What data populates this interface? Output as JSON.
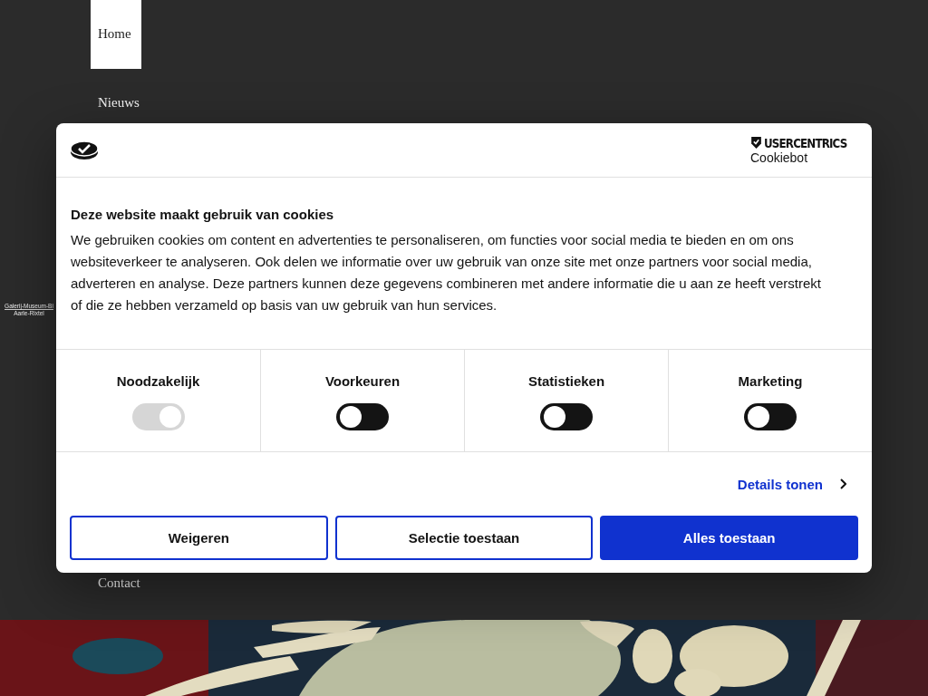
{
  "nav": [
    {
      "label": "Home",
      "selected": true
    },
    {
      "label": "Nieuws",
      "selected": false
    }
  ],
  "logo": {
    "line_1": "Galerij-Museum-Bi",
    "line_2": "Aarle-Rixtel"
  },
  "nav_bottom": {
    "label": "Contact"
  },
  "cookie_dialog": {
    "brand": "USERCENTRICS",
    "product": "Cookiebot",
    "title": "Deze website maakt gebruik van cookies",
    "text": "We gebruiken cookies om content en advertenties te personaliseren, om functies voor social media te bieden en om ons websiteverkeer te analyseren. Ook delen we informatie over uw gebruik van onze site met onze partners voor social media, adverteren en analyse. Deze partners kunnen deze gegevens combineren met andere informatie die u aan ze heeft verstrekt of die ze hebben verzameld op basis van uw gebruik van hun services.",
    "categories": [
      {
        "label": "Noodzakelijk",
        "on": true,
        "disabled": true
      },
      {
        "label": "Voorkeuren",
        "on": false,
        "disabled": false
      },
      {
        "label": "Statistieken",
        "on": false,
        "disabled": false
      },
      {
        "label": "Marketing",
        "on": false,
        "disabled": false
      }
    ],
    "details_link": "Details tonen",
    "buttons": [
      {
        "label": "Weigeren",
        "kind": "outline"
      },
      {
        "label": "Selectie toestaan",
        "kind": "outline"
      },
      {
        "label": "Alles toestaan",
        "kind": "primary"
      }
    ]
  }
}
